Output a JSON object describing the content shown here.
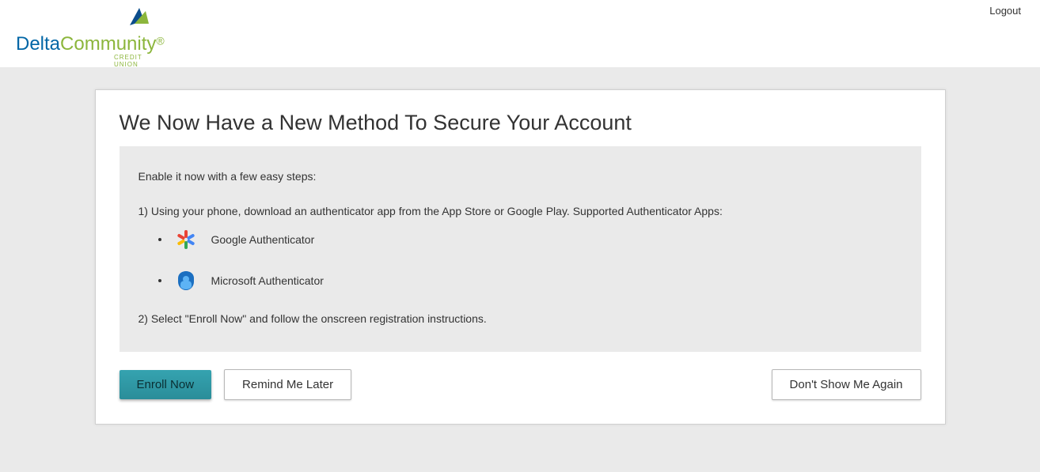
{
  "header": {
    "logo_text_1": "Delta",
    "logo_text_2": "Community",
    "logo_sub": "CREDIT UNION",
    "logout": "Logout"
  },
  "card": {
    "title": "We Now Have a New Method To Secure Your Account",
    "intro": "Enable it now with a few easy steps:",
    "step1": "1) Using your phone, download an authenticator app from the App Store or Google Play. Supported Authenticator Apps:",
    "apps": [
      {
        "name": "Google Authenticator"
      },
      {
        "name": "Microsoft Authenticator"
      }
    ],
    "step2": "2) Select \"Enroll Now\" and follow the onscreen registration instructions."
  },
  "buttons": {
    "enroll": "Enroll Now",
    "remind": "Remind Me Later",
    "dont_show": "Don't Show Me Again"
  }
}
